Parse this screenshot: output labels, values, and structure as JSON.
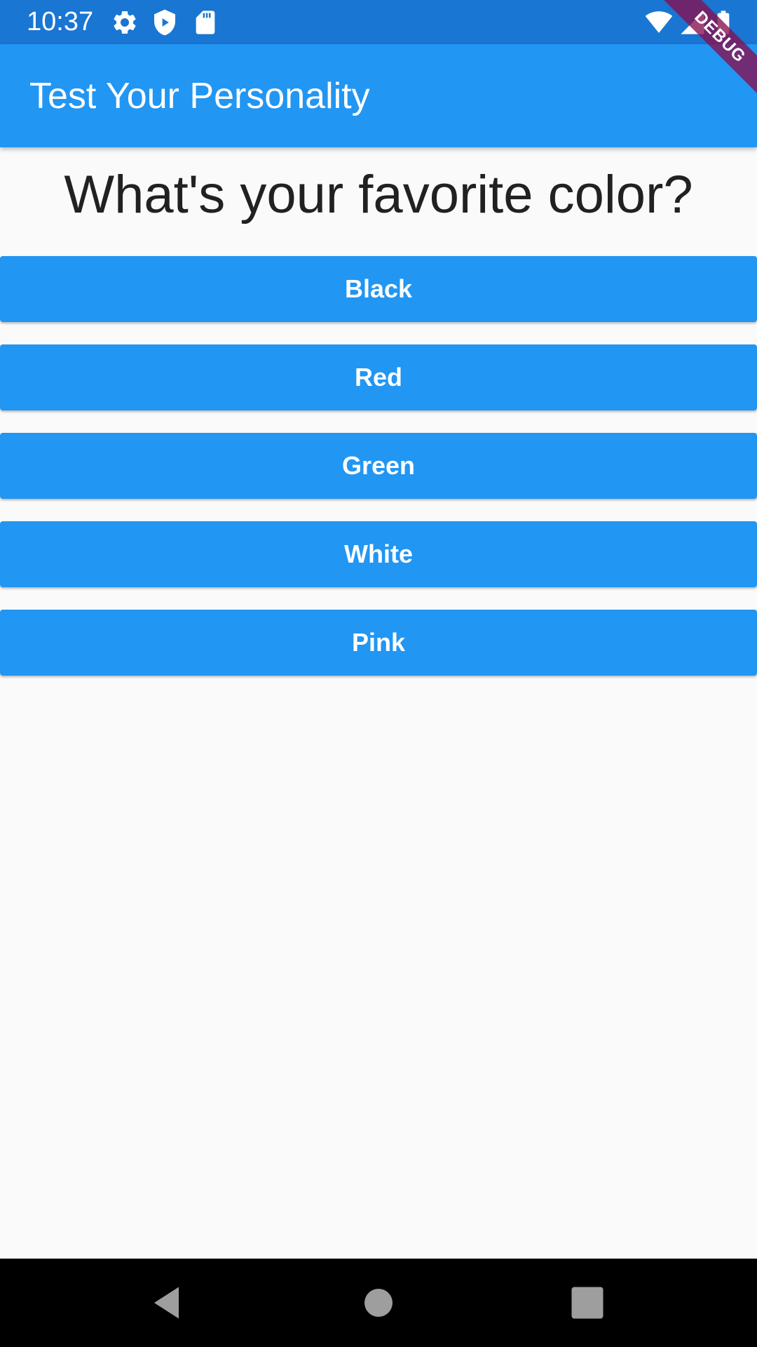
{
  "status_bar": {
    "time": "10:37",
    "icons": [
      "gear-icon",
      "shield-icon",
      "sd-card-icon",
      "wifi-icon",
      "signal-icon",
      "battery-icon"
    ]
  },
  "debug_banner": "DEBUG",
  "app_bar": {
    "title": "Test Your Personality"
  },
  "quiz": {
    "question": "What's your favorite color?",
    "answers": [
      "Black",
      "Red",
      "Green",
      "White",
      "Pink"
    ]
  },
  "nav_bar": {
    "icons": [
      "back-icon",
      "home-icon",
      "recents-icon"
    ]
  },
  "colors": {
    "status_bar": "#1976d2",
    "app_bar": "#2196f3",
    "button": "#2196f3",
    "background": "#fafafa",
    "nav_bar": "#000000"
  }
}
